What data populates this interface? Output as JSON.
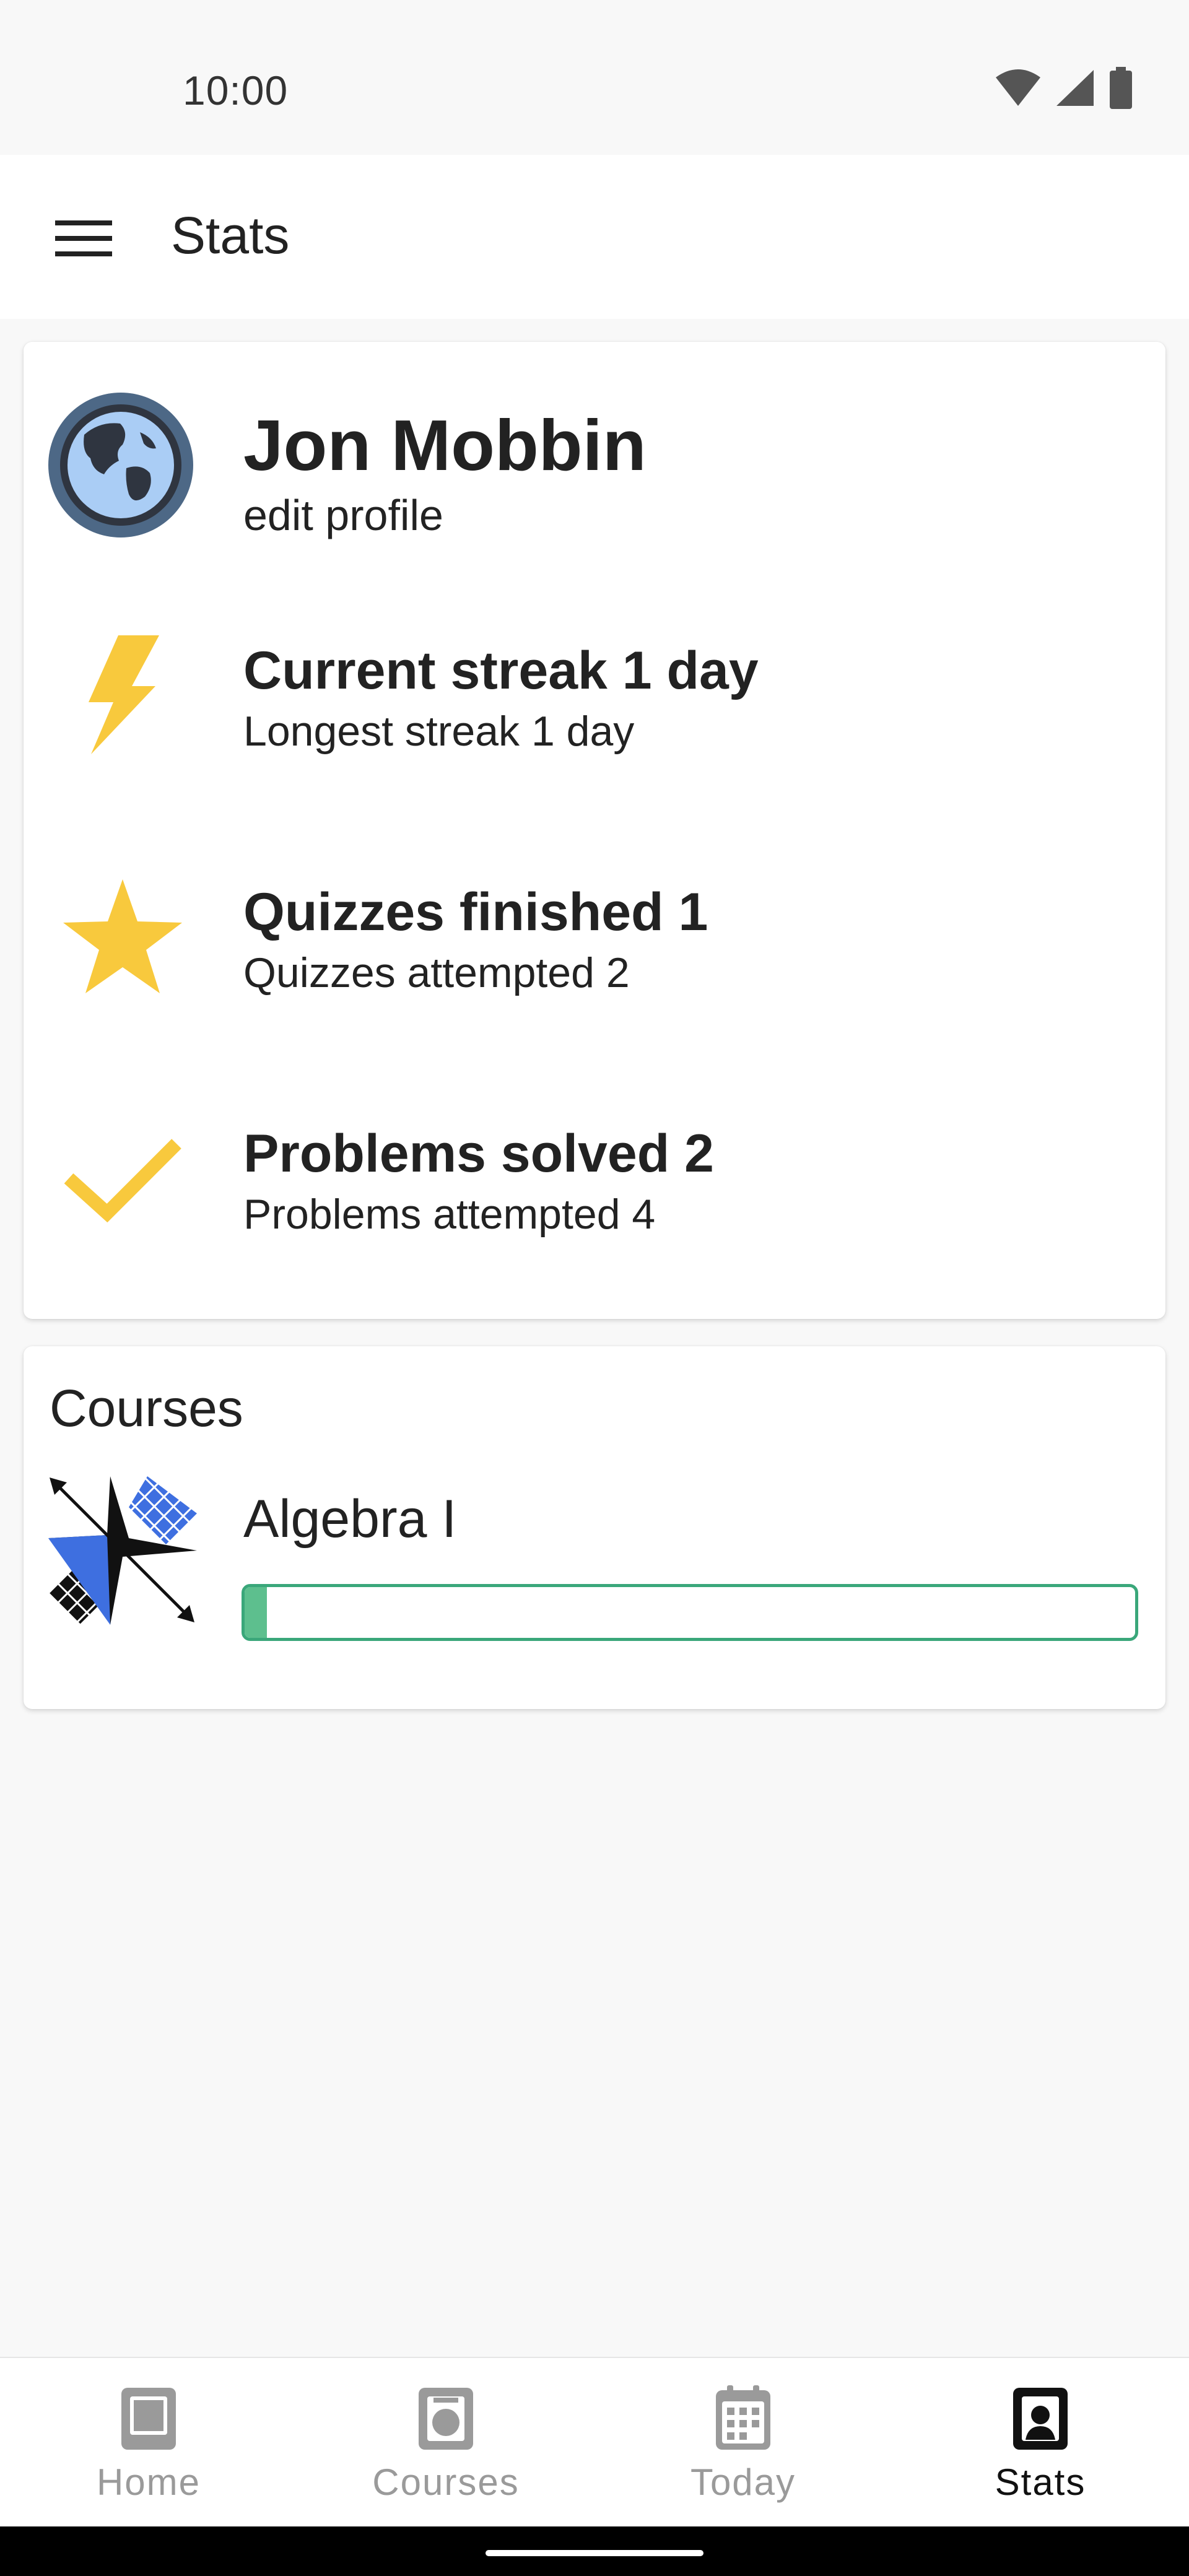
{
  "status_bar": {
    "time": "10:00",
    "icons": [
      "wifi-icon",
      "cellular-signal-icon",
      "battery-icon"
    ]
  },
  "app_bar": {
    "menu_icon": "hamburger-menu-icon",
    "title": "Stats"
  },
  "profile": {
    "name": "Jon Mobbin",
    "edit_link": "edit profile",
    "avatar_icon": "globe-avatar-icon"
  },
  "stats": {
    "streak": {
      "icon": "lightning-bolt-icon",
      "primary": "Current streak 1 day",
      "secondary": "Longest streak 1 day"
    },
    "quizzes": {
      "icon": "star-icon",
      "primary": "Quizzes finished 1",
      "secondary": "Quizzes attempted 2"
    },
    "problems": {
      "icon": "checkmark-icon",
      "primary": "Problems solved 2",
      "secondary": "Problems attempted 4"
    }
  },
  "courses": {
    "heading": "Courses",
    "items": [
      {
        "name": "Algebra I",
        "icon": "algebra-course-icon",
        "progress": 0.025
      }
    ]
  },
  "bottom_nav": {
    "items": [
      {
        "label": "Home",
        "icon": "home-tab-icon",
        "active": false
      },
      {
        "label": "Courses",
        "icon": "courses-tab-icon",
        "active": false
      },
      {
        "label": "Today",
        "icon": "calendar-tab-icon",
        "active": false
      },
      {
        "label": "Stats",
        "icon": "profile-card-icon",
        "active": true
      }
    ]
  },
  "colors": {
    "accent_yellow": "#f8c93d",
    "progress_green": "#3aa77a",
    "progress_fill": "#5dbf8e",
    "nav_active": "#111111",
    "nav_inactive": "#9a9a9a",
    "course_blue": "#3e6fe0"
  }
}
